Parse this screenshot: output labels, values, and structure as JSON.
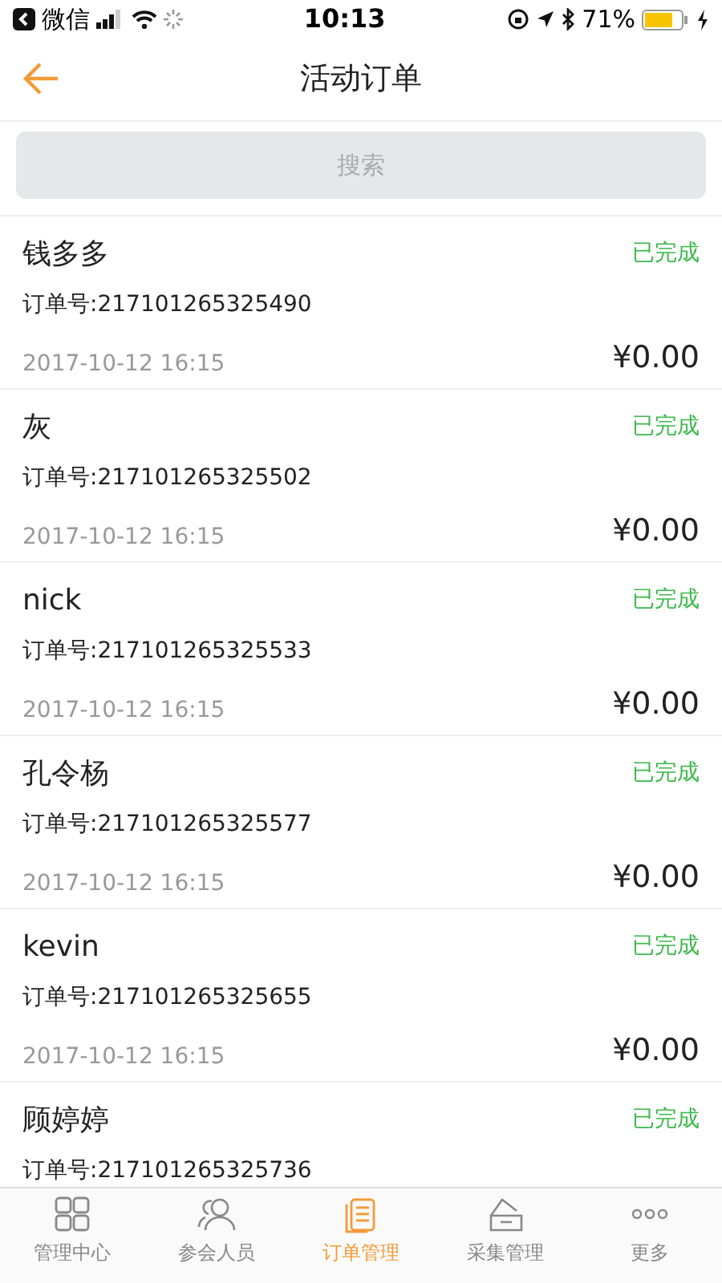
{
  "status_bar": {
    "back_app": "微信",
    "time": "10:13",
    "battery": "71%"
  },
  "header": {
    "title": "活动订单"
  },
  "search": {
    "placeholder": "搜索"
  },
  "orders": [
    {
      "name": "钱多多",
      "status": "已完成",
      "order_no": "订单号:217101265325490",
      "date": "2017-10-12 16:15",
      "amount": "¥0.00"
    },
    {
      "name": "灰",
      "status": "已完成",
      "order_no": "订单号:217101265325502",
      "date": "2017-10-12 16:15",
      "amount": "¥0.00"
    },
    {
      "name": "nick",
      "status": "已完成",
      "order_no": "订单号:217101265325533",
      "date": "2017-10-12 16:15",
      "amount": "¥0.00"
    },
    {
      "name": "孔令杨",
      "status": "已完成",
      "order_no": "订单号:217101265325577",
      "date": "2017-10-12 16:15",
      "amount": "¥0.00"
    },
    {
      "name": "kevin",
      "status": "已完成",
      "order_no": "订单号:217101265325655",
      "date": "2017-10-12 16:15",
      "amount": "¥0.00"
    },
    {
      "name": "顾婷婷",
      "status": "已完成",
      "order_no": "订单号:217101265325736"
    }
  ],
  "tab_bar": [
    {
      "label": "管理中心",
      "selected": false
    },
    {
      "label": "参会人员",
      "selected": false
    },
    {
      "label": "订单管理",
      "selected": true
    },
    {
      "label": "采集管理",
      "selected": false
    },
    {
      "label": "更多",
      "selected": false
    }
  ]
}
